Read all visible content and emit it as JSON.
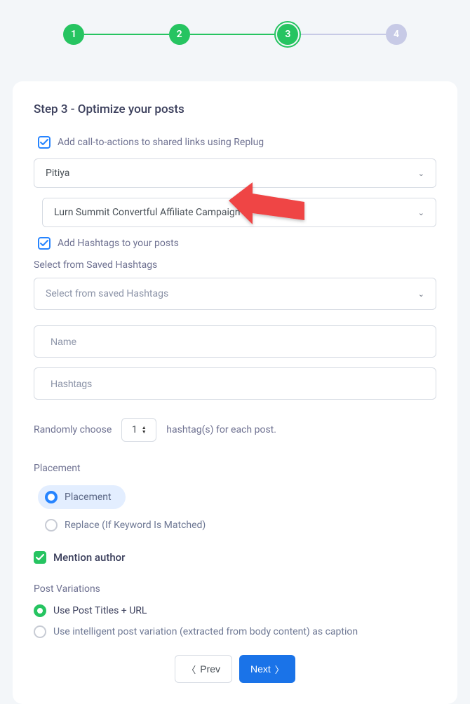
{
  "stepper": {
    "steps": [
      "1",
      "2",
      "3",
      "4"
    ],
    "current": 3
  },
  "card": {
    "title": "Step 3 - Optimize your posts",
    "cta_checkbox_label": "Add call-to-actions to shared links using Replug",
    "brand_select": {
      "value": "Pitiya"
    },
    "campaign_select": {
      "value": "Lurn Summit Convertful Affiliate Campaign"
    },
    "hashtag_checkbox_label": "Add Hashtags to your posts",
    "saved_hashtags_label": "Select from Saved Hashtags",
    "saved_hashtags_select_placeholder": "Select from saved Hashtags",
    "name_input_placeholder": "Name",
    "hashtags_input_placeholder": "Hashtags",
    "random_choose_prefix": "Randomly choose",
    "random_choose_suffix": "hashtag(s) for each post.",
    "random_count": "1",
    "placement_label": "Placement",
    "placement_options": {
      "placement": "Placement",
      "replace": "Replace (If Keyword Is Matched)"
    },
    "mention_author_label": "Mention author",
    "post_variations_label": "Post Variations",
    "post_variation_options": {
      "titles_url": "Use Post Titles + URL",
      "intelligent": "Use intelligent post variation (extracted from body content) as caption"
    },
    "buttons": {
      "prev": "Prev",
      "next": "Next"
    }
  }
}
